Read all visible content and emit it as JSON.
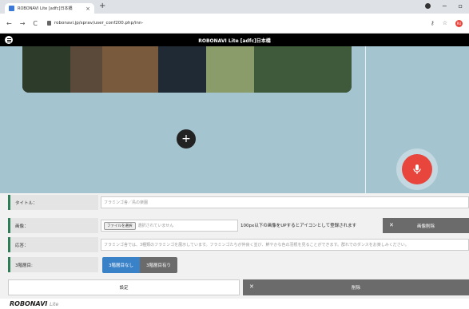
{
  "browser": {
    "tab_title": "ROBONAVI Lite [adfc]日本橋",
    "tab_close": "×",
    "new_tab": "+",
    "url": "robonavi.jp/sprav/user_conf200.php/inn-",
    "back": "←",
    "forward": "→",
    "reload": "C",
    "avatar_text": "RU"
  },
  "app": {
    "title": "ROBONAVI Lite [adfc]日本橋"
  },
  "map": {
    "add_label": "+"
  },
  "form": {
    "title_label": "タイトル：",
    "title_value": "フラミンゴ舎／鳥の楽園",
    "image_label": "画像：",
    "file_button": "ファイルを選択",
    "file_status": "選択されていません",
    "image_hint": "100px以下の画像をUPするとアイコンとして登録されます",
    "image_delete": "画像削除",
    "answer_label": "応答：",
    "answer_value": "フラミンゴ舎では、3種類のフラミンゴを展示しています。フラミンゴたちが仲良く並び、鮮やかな色の羽根を見ることができます。群れでのダンスをお楽しみください。",
    "third_label": "3階層目:",
    "third_off": "3階層目なし",
    "third_on": "3階層目有り",
    "save_button": "設定",
    "delete_button": "削除"
  },
  "footer": {
    "brand": "ROBONAVI",
    "brand_sub": "Lite"
  },
  "colors": {
    "map_bg": "#a4c4cf",
    "accent_green": "#2e7d56",
    "mic_red": "#e8453c",
    "seg_blue": "#3a82c8"
  }
}
